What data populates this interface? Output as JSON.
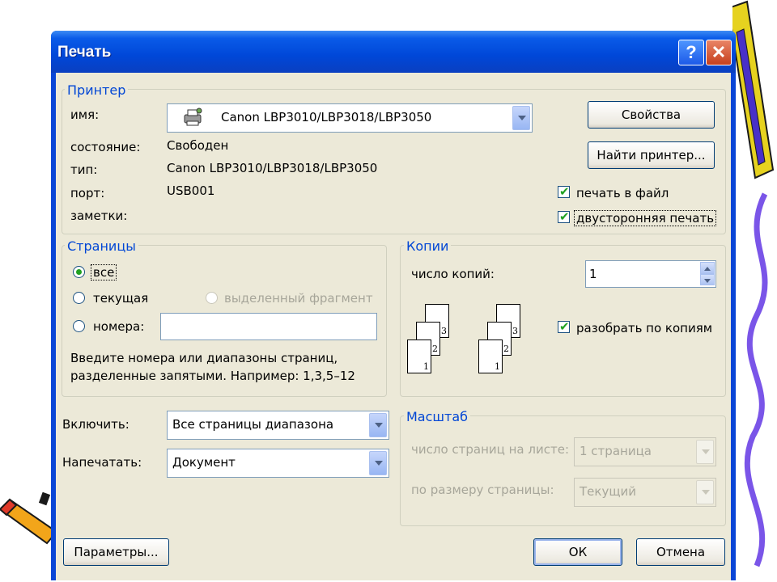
{
  "window": {
    "title": "Печать",
    "help_label": "?",
    "close_label": "✕"
  },
  "printer": {
    "legend": "Принтер",
    "name_label": "имя:",
    "name_value": "Canon LBP3010/LBP3018/LBP3050",
    "status_label": "состояние:",
    "status_value": "Свободен",
    "type_label": "тип:",
    "type_value": "Canon LBP3010/LBP3018/LBP3050",
    "port_label": "порт:",
    "port_value": "USB001",
    "notes_label": "заметки:",
    "properties_button": "Свойства",
    "find_printer_button": "Найти принтер...",
    "print_to_file_label": "печать в файл",
    "print_to_file_checked": true,
    "duplex_label": "двусторонняя печать",
    "duplex_checked": true
  },
  "pages": {
    "legend": "Страницы",
    "all_label": "все",
    "current_label": "текущая",
    "selection_label": "выделенный фрагмент",
    "numbers_label": "номера:",
    "numbers_value": "",
    "selected": "all",
    "hint_line1": "Введите номера или диапазоны страниц,",
    "hint_line2": "разделенные запятыми. Например: 1,3,5–12"
  },
  "copies": {
    "legend": "Копии",
    "count_label": "число копий:",
    "count_value": "1",
    "collate_label": "разобрать по копиям",
    "collate_checked": true,
    "page_numbers": [
      "1",
      "2",
      "3"
    ]
  },
  "include": {
    "label": "Включить:",
    "value": "Все страницы диапазона"
  },
  "print_what": {
    "label": "Напечатать:",
    "value": "Документ"
  },
  "zoom": {
    "legend": "Масштаб",
    "pages_per_sheet_label": "число страниц на листе:",
    "pages_per_sheet_value": "1 страница",
    "scale_label": "по размеру страницы:",
    "scale_value": "Текущий"
  },
  "footer": {
    "options_button": "Параметры...",
    "ok_button": "ОК",
    "cancel_button": "Отмена"
  },
  "colors": {
    "title_bar": "#0047d8",
    "client": "#ece9d8",
    "legend": "#0046d5",
    "check": "#21a121"
  }
}
